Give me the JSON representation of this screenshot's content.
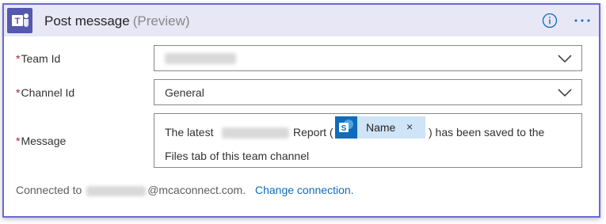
{
  "header": {
    "title": "Post message",
    "preview": "(Preview)",
    "info_icon": "info-icon",
    "more_icon": "more-options-icon"
  },
  "fields": {
    "team_id": {
      "required_mark": "*",
      "label": "Team Id"
    },
    "channel_id": {
      "required_mark": "*",
      "label": "Channel Id",
      "value": "General"
    },
    "message": {
      "required_mark": "*",
      "label": "Message",
      "text_before": "The latest",
      "text_mid": "Report (",
      "token_label": "Name",
      "token_close": "×",
      "text_after": ") has been saved to the",
      "line2": "Files tab of this team channel"
    }
  },
  "footer": {
    "connected_prefix": "Connected to",
    "connected_suffix": "@mcaconnect.com.",
    "change_link": "Change connection."
  },
  "colors": {
    "border_accent": "#6b69d6",
    "header_bg": "#e7e7f6",
    "teams_purple": "#5558af",
    "link_blue": "#0f6cbd",
    "required_red": "#a4262c",
    "token_bg": "#cfe4f6"
  }
}
